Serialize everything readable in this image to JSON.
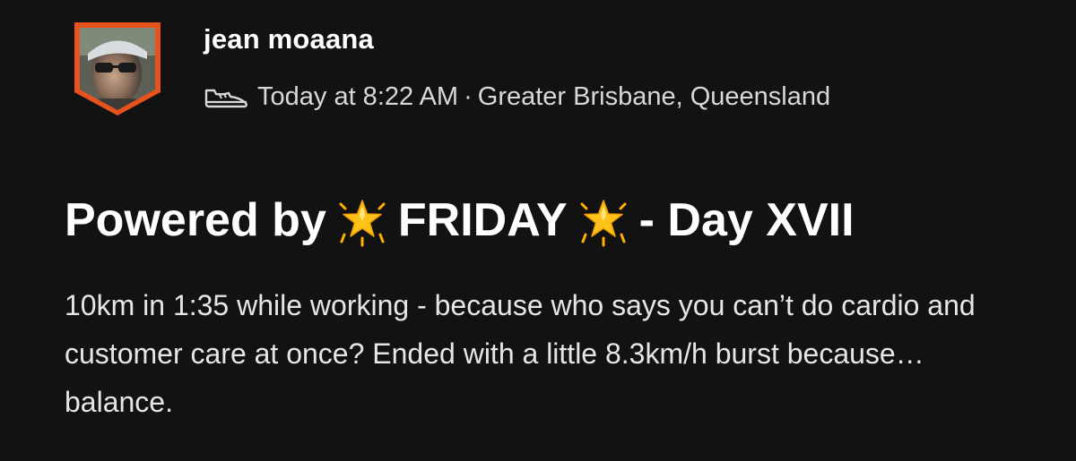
{
  "athlete": {
    "name": "jean moaana",
    "avatar_frame_color": "#e8531d"
  },
  "activity": {
    "sport_icon": "shoe-icon",
    "timestamp": "Today at 8:22 AM",
    "separator": "·",
    "location": "Greater Brisbane, Queensland",
    "title_parts": {
      "part1": "Powered by",
      "emoji1": "glowing-star-icon",
      "part2": "FRIDAY",
      "emoji2": "glowing-star-icon",
      "part3": "- Day XVII"
    },
    "description": "10km in 1:35 while working - because who says you can’t do cardio and customer care at once? Ended with a little 8.3km/h burst because… balance."
  },
  "colors": {
    "background": "#121212",
    "text_primary": "#ffffff",
    "text_secondary": "#d8d8d8",
    "star_gold": "#ffc21a"
  }
}
